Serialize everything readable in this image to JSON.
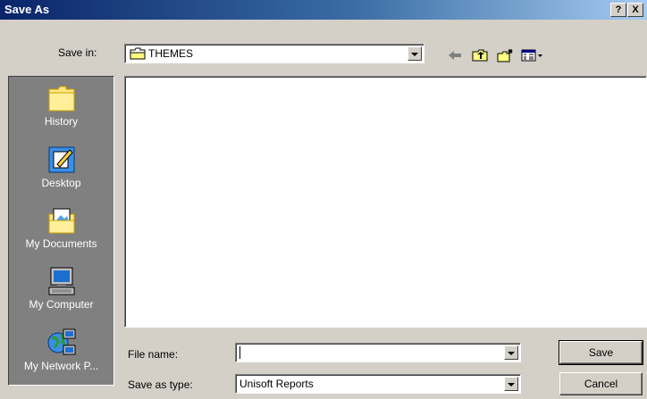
{
  "window": {
    "title": "Save As",
    "help_label": "?",
    "close_label": "X"
  },
  "save_in": {
    "label": "Save in:",
    "value": "THEMES"
  },
  "toolbar": {
    "back_icon": "back-arrow-icon",
    "up_icon": "up-one-level-icon",
    "new_folder_icon": "new-folder-icon",
    "views_icon": "views-menu-icon"
  },
  "places": [
    {
      "label": "History",
      "icon": "history-folder-icon"
    },
    {
      "label": "Desktop",
      "icon": "desktop-icon"
    },
    {
      "label": "My Documents",
      "icon": "my-documents-icon"
    },
    {
      "label": "My Computer",
      "icon": "my-computer-icon"
    },
    {
      "label": "My Network P...",
      "icon": "network-places-icon"
    }
  ],
  "file_name": {
    "label": "File name:",
    "value": ""
  },
  "save_type": {
    "label": "Save as type:",
    "value": "Unisoft Reports"
  },
  "buttons": {
    "save": "Save",
    "cancel": "Cancel"
  }
}
